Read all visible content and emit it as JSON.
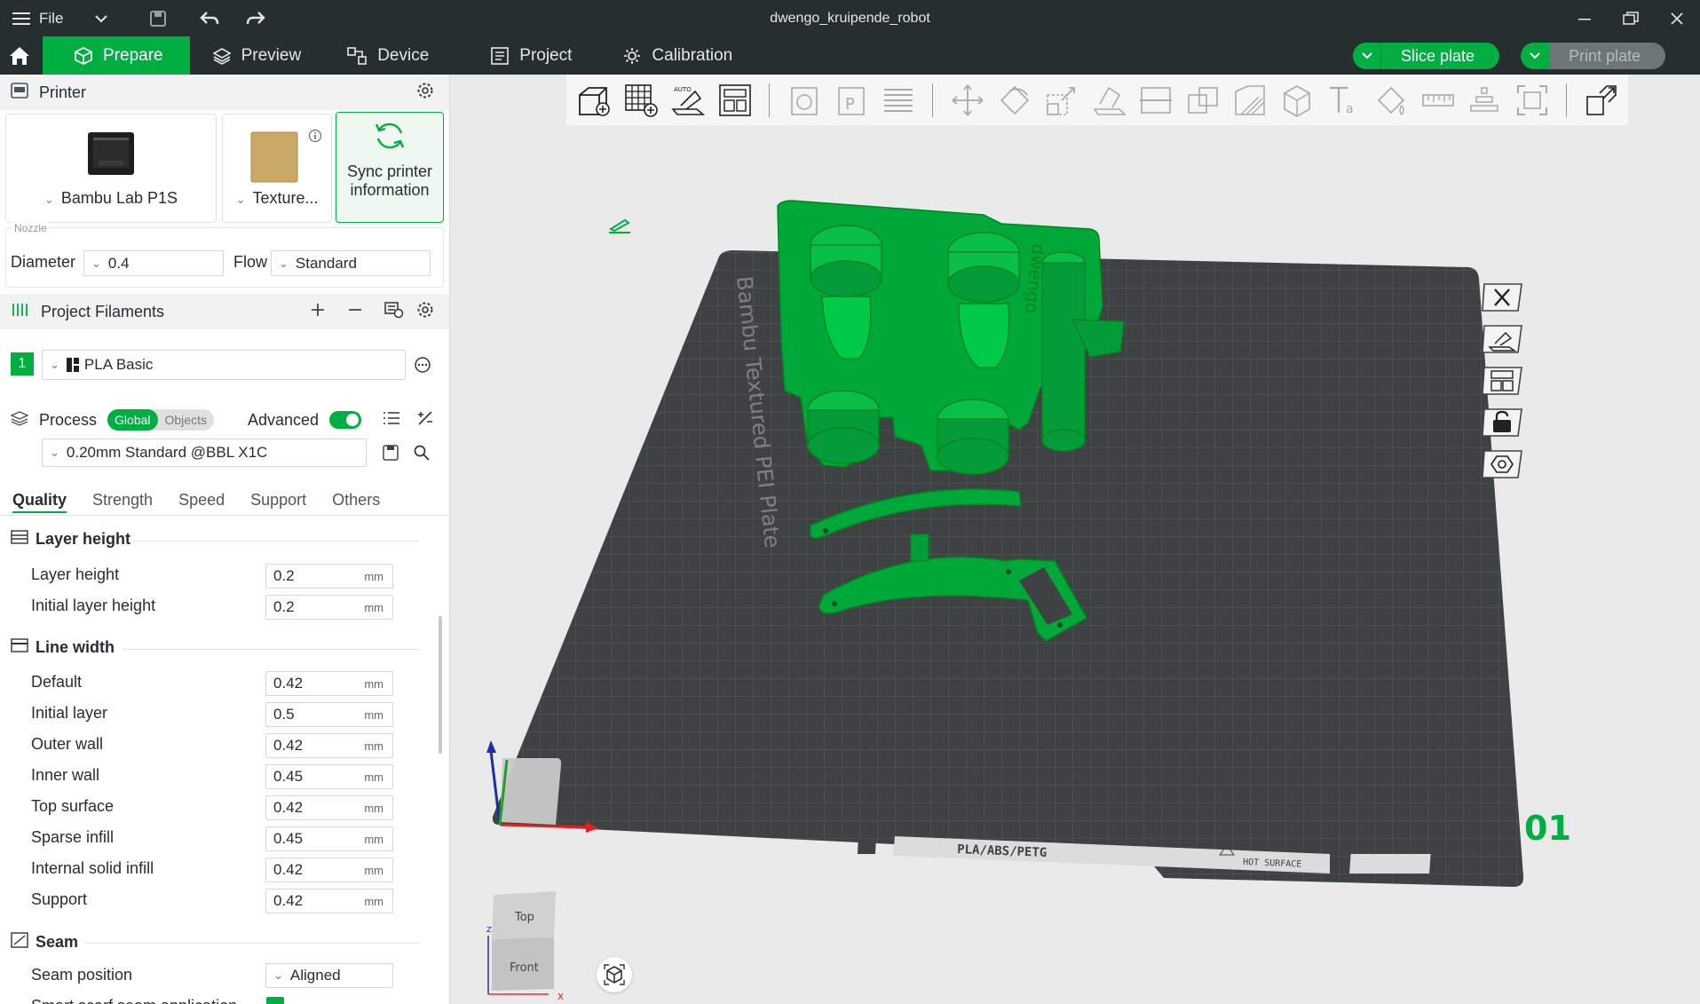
{
  "window": {
    "title": "dwengo_kruipende_robot",
    "file_menu": "File"
  },
  "tabs": [
    {
      "label": "Prepare",
      "icon": "cube-icon"
    },
    {
      "label": "Preview",
      "icon": "layers-icon"
    },
    {
      "label": "Device",
      "icon": "device-icon"
    },
    {
      "label": "Project",
      "icon": "project-icon"
    },
    {
      "label": "Calibration",
      "icon": "calibration-icon"
    }
  ],
  "actions": {
    "slice_label": "Slice plate",
    "print_label": "Print plate"
  },
  "printer": {
    "section_title": "Printer",
    "printer_name": "Bambu Lab P1S",
    "plate_type": "Texture...",
    "sync_label": "Sync printer information",
    "nozzle_label": "Nozzle",
    "diameter_label": "Diameter",
    "diameter_value": "0.4",
    "flow_label": "Flow",
    "flow_value": "Standard"
  },
  "filaments": {
    "section_title": "Project Filaments",
    "items": [
      {
        "index": "1",
        "name": "PLA Basic",
        "color": "#00ae42"
      }
    ]
  },
  "process": {
    "section_title": "Process",
    "scope_global": "Global",
    "scope_objects": "Objects",
    "advanced_label": "Advanced",
    "preset": "0.20mm Standard @BBL X1C",
    "subtabs": [
      "Quality",
      "Strength",
      "Speed",
      "Support",
      "Others"
    ],
    "unit": "mm",
    "groups": {
      "layer_height": {
        "title": "Layer height",
        "rows": [
          {
            "label": "Layer height",
            "value": "0.2"
          },
          {
            "label": "Initial layer height",
            "value": "0.2"
          }
        ]
      },
      "line_width": {
        "title": "Line width",
        "rows": [
          {
            "label": "Default",
            "value": "0.42"
          },
          {
            "label": "Initial layer",
            "value": "0.5"
          },
          {
            "label": "Outer wall",
            "value": "0.42"
          },
          {
            "label": "Inner wall",
            "value": "0.45"
          },
          {
            "label": "Top surface",
            "value": "0.42"
          },
          {
            "label": "Sparse infill",
            "value": "0.45"
          },
          {
            "label": "Internal solid infill",
            "value": "0.42"
          },
          {
            "label": "Support",
            "value": "0.42"
          }
        ]
      },
      "seam": {
        "title": "Seam",
        "rows": [
          {
            "label": "Seam position",
            "value": "Aligned"
          },
          {
            "label": "Smart scarf seam application",
            "value": ""
          }
        ]
      }
    }
  },
  "viewport": {
    "plate_label": "Bambu Textured PEI Plate",
    "plate_material_text": "PLA/ABS/PETG",
    "hot_surface_text": "HOT SURFACE",
    "plate_number": "01",
    "model_text": "dwengo",
    "navcube_top": "Top",
    "navcube_front": "Front",
    "axis_z": "z",
    "axis_x": "x"
  },
  "colors": {
    "accent": "#00ae42",
    "titlebar": "#262e30",
    "bed": "#3e4243",
    "model": "#00a83a"
  }
}
